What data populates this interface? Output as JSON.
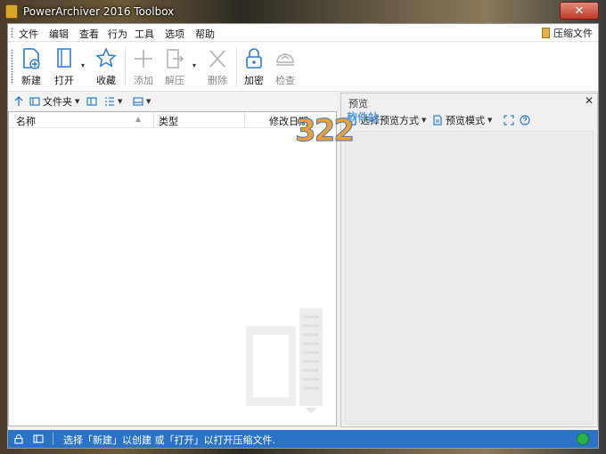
{
  "window": {
    "title": "PowerArchiver 2016 Toolbox",
    "close_glyph": "✕"
  },
  "menu": {
    "items": [
      "文件",
      "编辑",
      "查看",
      "行为",
      "工具",
      "选项",
      "帮助"
    ],
    "archive_button": "压缩文件"
  },
  "toolbar": {
    "buttons": [
      {
        "label": "新建",
        "icon": "new-archive-icon",
        "enabled": true
      },
      {
        "label": "打开",
        "icon": "open-archive-icon",
        "enabled": true
      },
      {
        "label": "收藏",
        "icon": "favorites-star-icon",
        "enabled": true
      },
      {
        "label": "添加",
        "icon": "add-plus-icon",
        "enabled": false
      },
      {
        "label": "解压",
        "icon": "extract-icon",
        "enabled": false
      },
      {
        "label": "删除",
        "icon": "delete-x-icon",
        "enabled": false
      },
      {
        "label": "加密",
        "icon": "lock-icon",
        "enabled": true
      },
      {
        "label": "检查",
        "icon": "check-test-icon",
        "enabled": false
      }
    ]
  },
  "left_bar": {
    "folder_label": "文件夹"
  },
  "file_list": {
    "columns": [
      "名称",
      "类型",
      "修改日期"
    ]
  },
  "preview": {
    "title": "预览",
    "close_glyph": "✕",
    "select_mode_label": "选择预览方式",
    "preview_mode_label": "预览模式"
  },
  "watermark": {
    "number": "322",
    "text": "软件站"
  },
  "status": {
    "message": "选择「新建」以创建 或「打开」以打开压缩文件.",
    "accent_color": "#2a73c6",
    "indicator_color": "#28b44a"
  }
}
